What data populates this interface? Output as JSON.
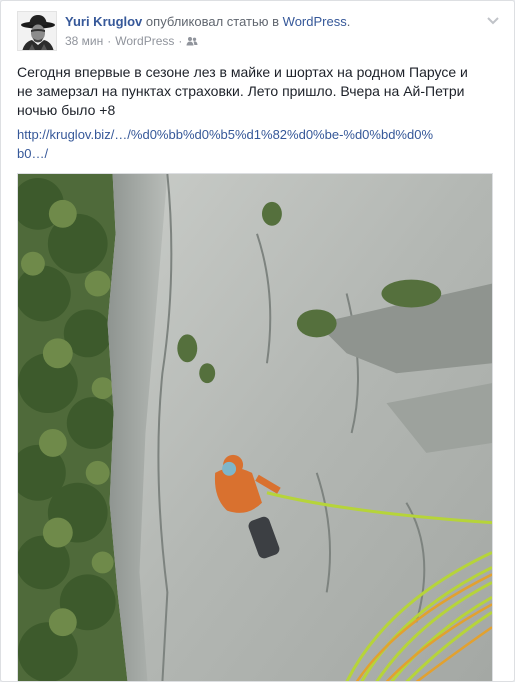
{
  "post": {
    "author": "Yuri Kruglov",
    "action": "опубликовал статью в",
    "target": "WordPress",
    "target_suffix": ".",
    "time": "38 мин",
    "separator": "·",
    "source": "WordPress",
    "privacy_icon": "friends-icon",
    "menu_icon": "chevron-down-icon",
    "text": "Сегодня впервые в сезоне лез в майке и шортах на родном Парусе и не замерзал на пунктах страховки. Лето пришло. Вчера на Ай-Петри ночью было +8",
    "link": "http://kruglov.biz/…/%d0%bb%d0%b5%d1%82%d0%be-%d0%bd%d0%b0…/"
  },
  "colors": {
    "link": "#365899",
    "meta": "#90949c",
    "text": "#1d2129"
  }
}
